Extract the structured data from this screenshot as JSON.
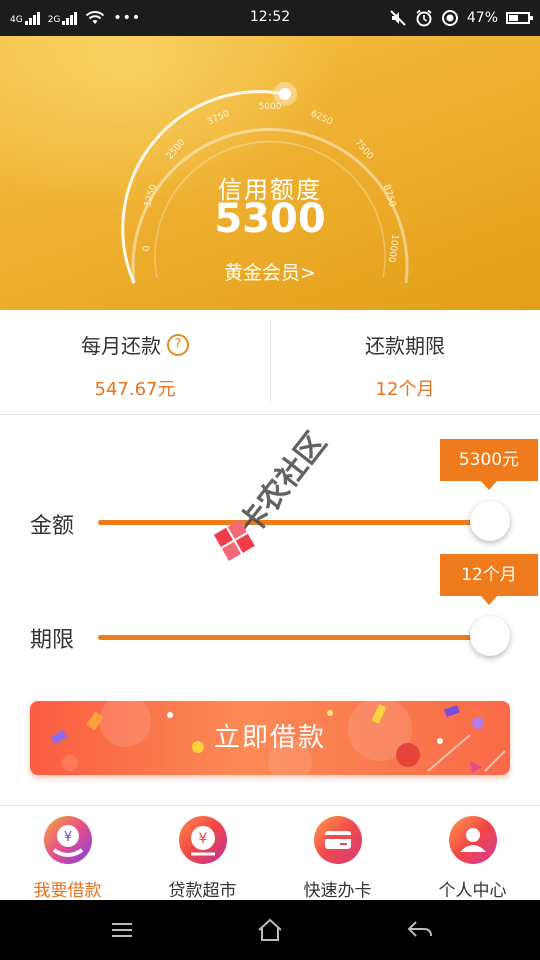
{
  "status_bar": {
    "signal1": "4G",
    "signal2": "2G",
    "more": "•••",
    "time": "12:52",
    "battery": "47%"
  },
  "header": {
    "gauge_ticks": [
      "0",
      "1250",
      "2500",
      "3750",
      "5000",
      "6250",
      "7500",
      "8750",
      "10000"
    ],
    "title": "信用额度",
    "amount": "5300",
    "member": "黄金会员>"
  },
  "info": {
    "monthly_label": "每月还款",
    "monthly_value": "547.67元",
    "term_label": "还款期限",
    "term_value": "12个月"
  },
  "sliders": {
    "amount_label": "金额",
    "amount_value": "5300元",
    "amount_level": 1.0,
    "term_label": "期限",
    "term_value": "12个月",
    "term_level": 1.0
  },
  "watermark": "卡农社区",
  "borrow_button": "立即借款",
  "nav": [
    {
      "label": "我要借款",
      "active": true
    },
    {
      "label": "贷款超市",
      "active": false
    },
    {
      "label": "快速办卡",
      "active": false
    },
    {
      "label": "个人中心",
      "active": false
    }
  ],
  "colors": {
    "accent": "#ef7b1c",
    "header_gold": "#efb131",
    "button": "#fb6a48"
  }
}
